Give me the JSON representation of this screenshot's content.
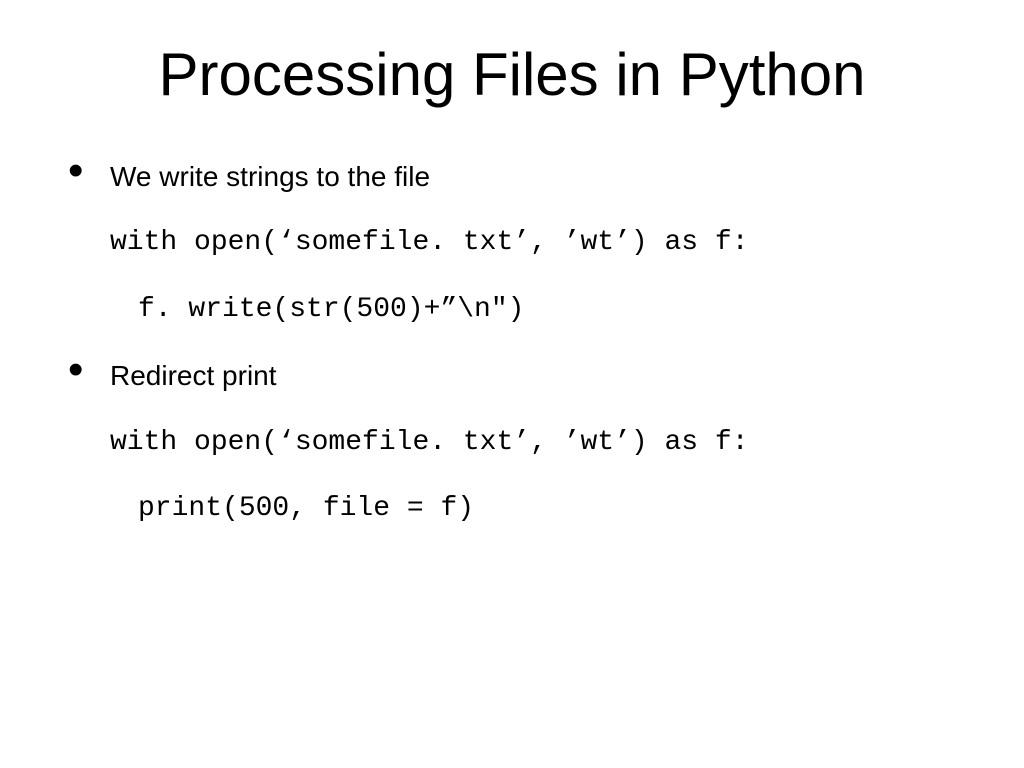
{
  "title": "Processing Files in Python",
  "bullets": [
    {
      "text": "We write strings to the file",
      "code": [
        "with open(‘somefile. txt’, ’wt’) as f:",
        "f. write(str(500)+”\\n\")"
      ]
    },
    {
      "text": "Redirect print",
      "code": [
        "with open(‘somefile. txt’, ’wt’) as f:",
        "print(500, file = f)"
      ]
    }
  ]
}
